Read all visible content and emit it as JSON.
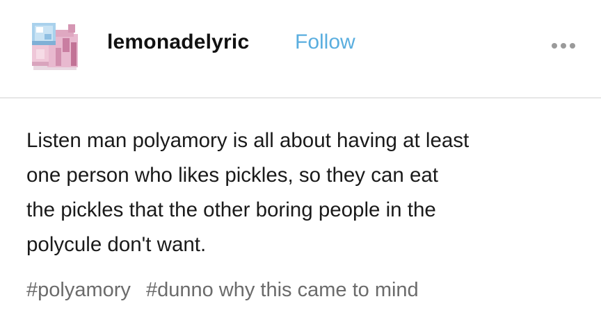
{
  "post": {
    "username": "lemonadelyric",
    "follow_label": "Follow",
    "more_icon": "more-dots-icon",
    "avatar_icon": "pixel-snail-avatar",
    "body_lines": [
      "Listen man polyamory is all about having at least",
      "one person who likes pickles, so they can eat",
      "the pickles that the other boring people in the",
      "polycule don't want."
    ],
    "tags": [
      "#polyamory",
      "#dunno why this came to mind"
    ]
  },
  "colors": {
    "follow": "#5aaedf",
    "tags": "#6b6b6b",
    "text": "#1a1a1a",
    "divider": "#e6e6e6"
  }
}
